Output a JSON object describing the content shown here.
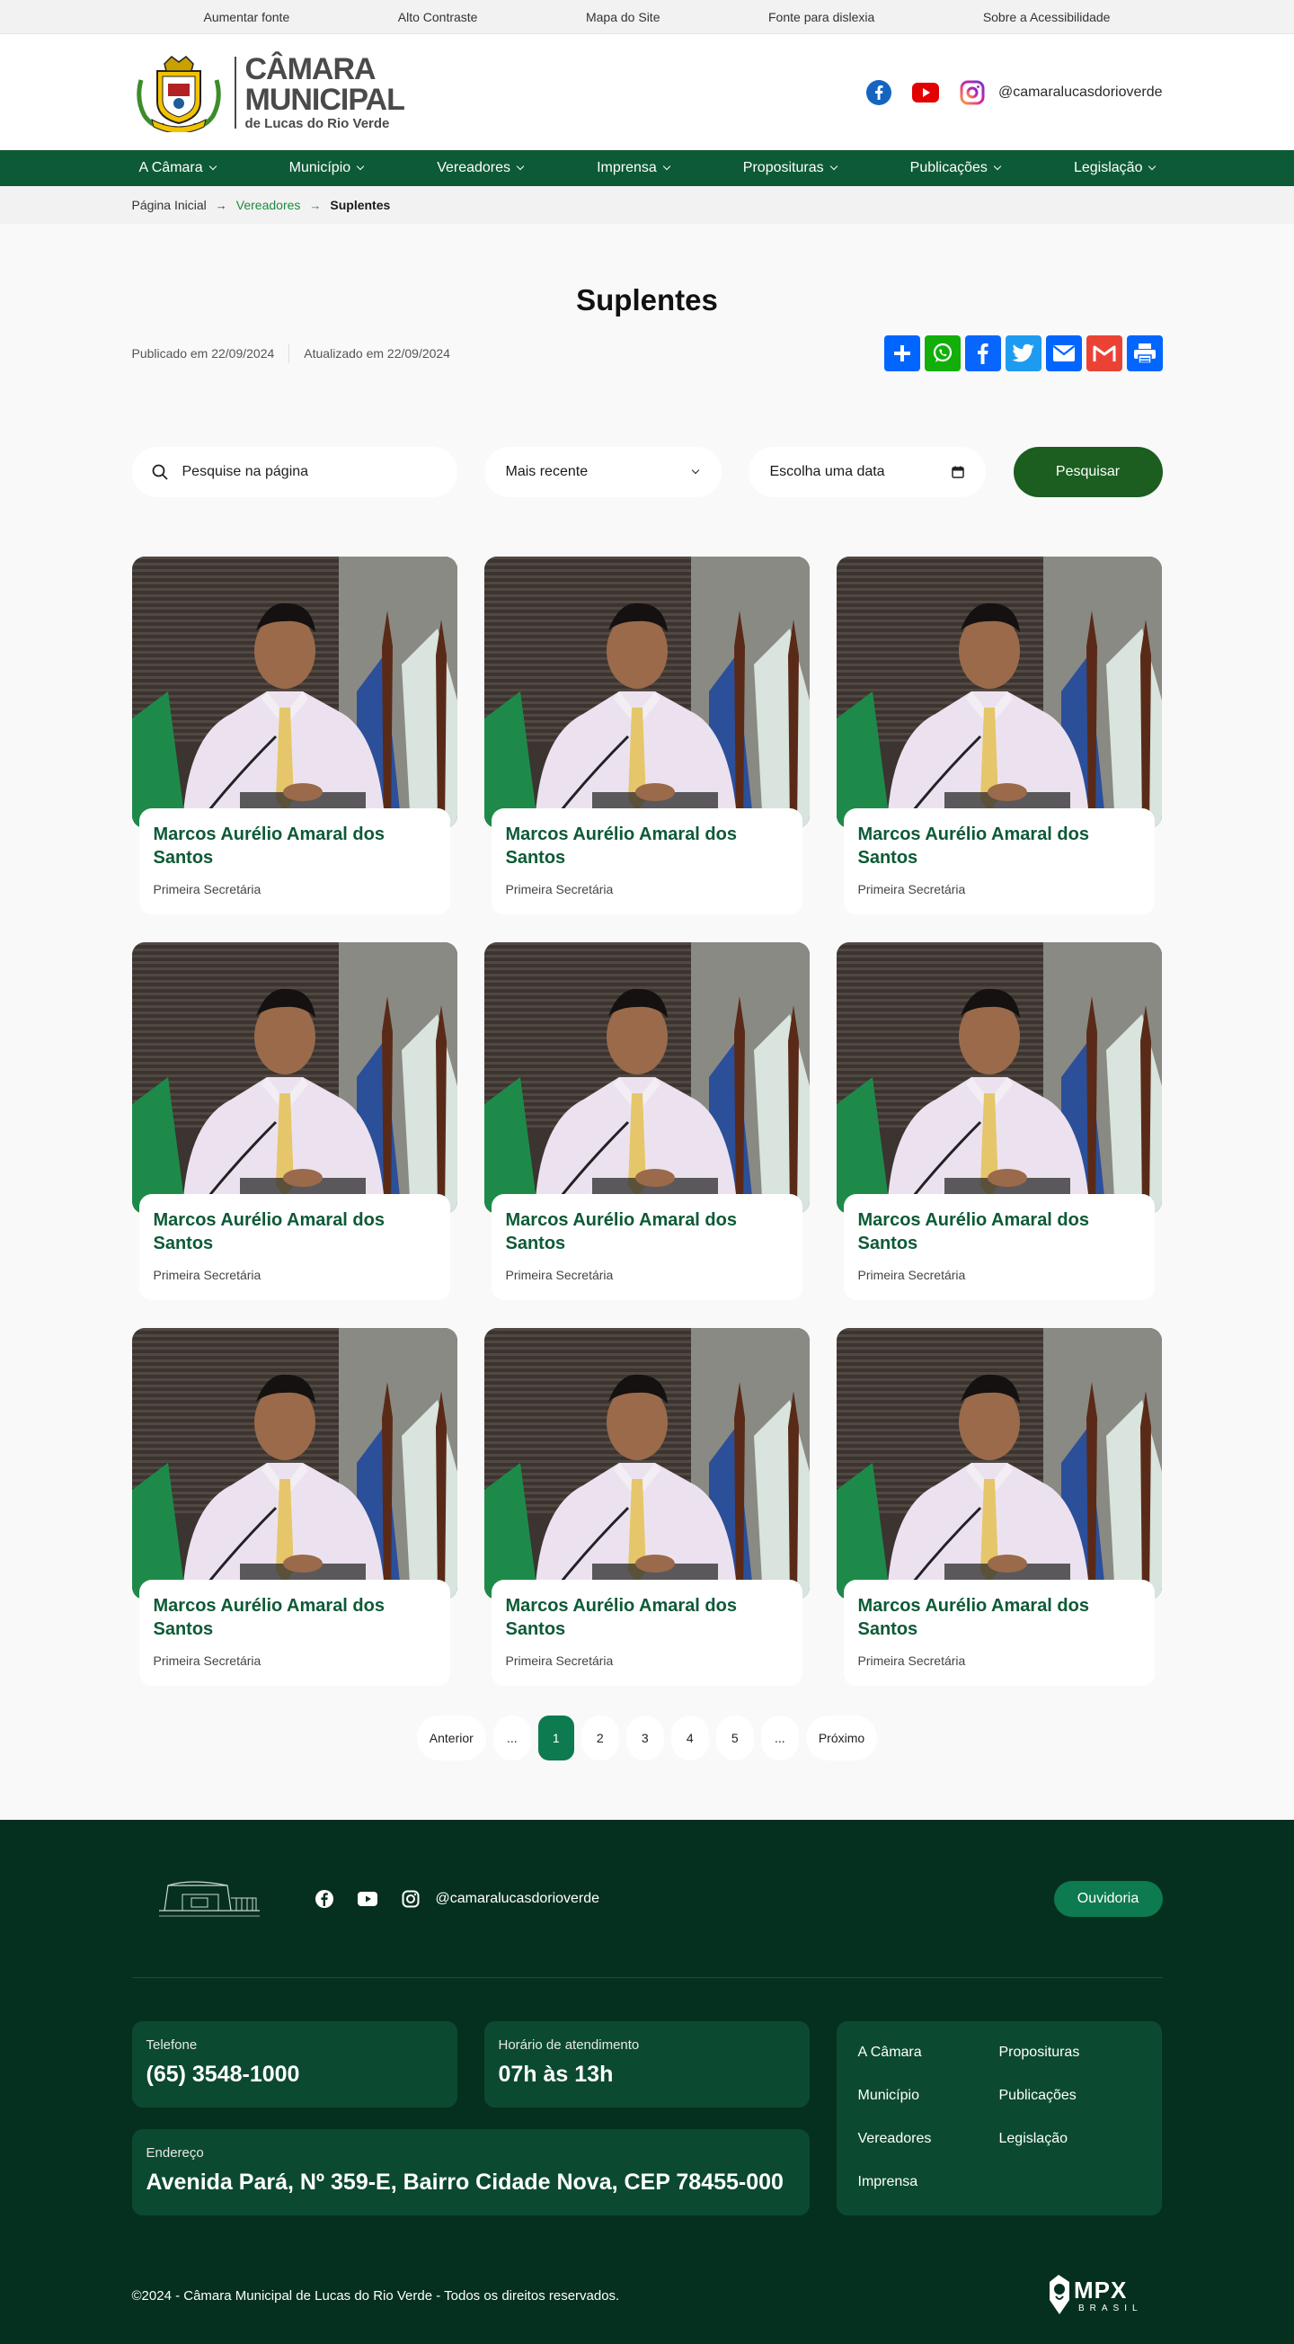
{
  "accessibility": {
    "items": [
      "Aumentar fonte",
      "Alto Contraste",
      "Mapa do Site",
      "Fonte para dislexia",
      "Sobre a Acessibilidade"
    ]
  },
  "logo": {
    "line1": "CÂMARA",
    "line2": "MUNICIPAL",
    "line3": "de Lucas do Rio Verde"
  },
  "header": {
    "social_handle": "@camaralucasdorioverde"
  },
  "nav": {
    "items": [
      "A Câmara",
      "Município",
      "Vereadores",
      "Imprensa",
      "Proposituras",
      "Publicações",
      "Legislação"
    ]
  },
  "breadcrumb": {
    "home": "Página Inicial",
    "section": "Vereadores",
    "current": "Suplentes"
  },
  "page": {
    "title": "Suplentes",
    "published": "Publicado em 22/09/2024",
    "updated": "Atualizado em 22/09/2024"
  },
  "filters": {
    "search_placeholder": "Pesquise na página",
    "sort_value": "Mais recente",
    "date_placeholder": "Escolha uma data",
    "button": "Pesquisar"
  },
  "cards": [
    {
      "name": "Marcos Aurélio Amaral dos Santos",
      "role": "Primeira Secretária"
    },
    {
      "name": "Marcos Aurélio Amaral dos Santos",
      "role": "Primeira Secretária"
    },
    {
      "name": "Marcos Aurélio Amaral dos Santos",
      "role": "Primeira Secretária"
    },
    {
      "name": "Marcos Aurélio Amaral dos Santos",
      "role": "Primeira Secretária"
    },
    {
      "name": "Marcos Aurélio Amaral dos Santos",
      "role": "Primeira Secretária"
    },
    {
      "name": "Marcos Aurélio Amaral dos Santos",
      "role": "Primeira Secretária"
    },
    {
      "name": "Marcos Aurélio Amaral dos Santos",
      "role": "Primeira Secretária"
    },
    {
      "name": "Marcos Aurélio Amaral dos Santos",
      "role": "Primeira Secretária"
    },
    {
      "name": "Marcos Aurélio Amaral dos Santos",
      "role": "Primeira Secretária"
    }
  ],
  "pagination": {
    "prev": "Anterior",
    "next": "Próximo",
    "ellipsis": "...",
    "pages": [
      "1",
      "2",
      "3",
      "4",
      "5"
    ],
    "current": "1"
  },
  "footer": {
    "social_handle": "@camaralucasdorioverde",
    "ouvidoria": "Ouvidoria",
    "phone_label": "Telefone",
    "phone": "(65) 3548-1000",
    "hours_label": "Horário de atendimento",
    "hours": "07h às 13h",
    "address_label": "Endereço",
    "address": "Avenida Pará, Nº 359-E, Bairro Cidade Nova, CEP 78455-000",
    "links": [
      "A Câmara",
      "Proposituras",
      "Município",
      "Publicações",
      "Vereadores",
      "Legislação",
      "Imprensa"
    ],
    "copyright": "©2024 - Câmara Municipal de Lucas do Rio Verde - Todos os direitos reservados.",
    "brand": "MPX",
    "brand_sub": "BRASIL"
  },
  "colors": {
    "primary_green": "#0d5a36",
    "dark_footer": "#05301f",
    "accent_green": "#0e7a4f",
    "button_green": "#1b5e20"
  }
}
